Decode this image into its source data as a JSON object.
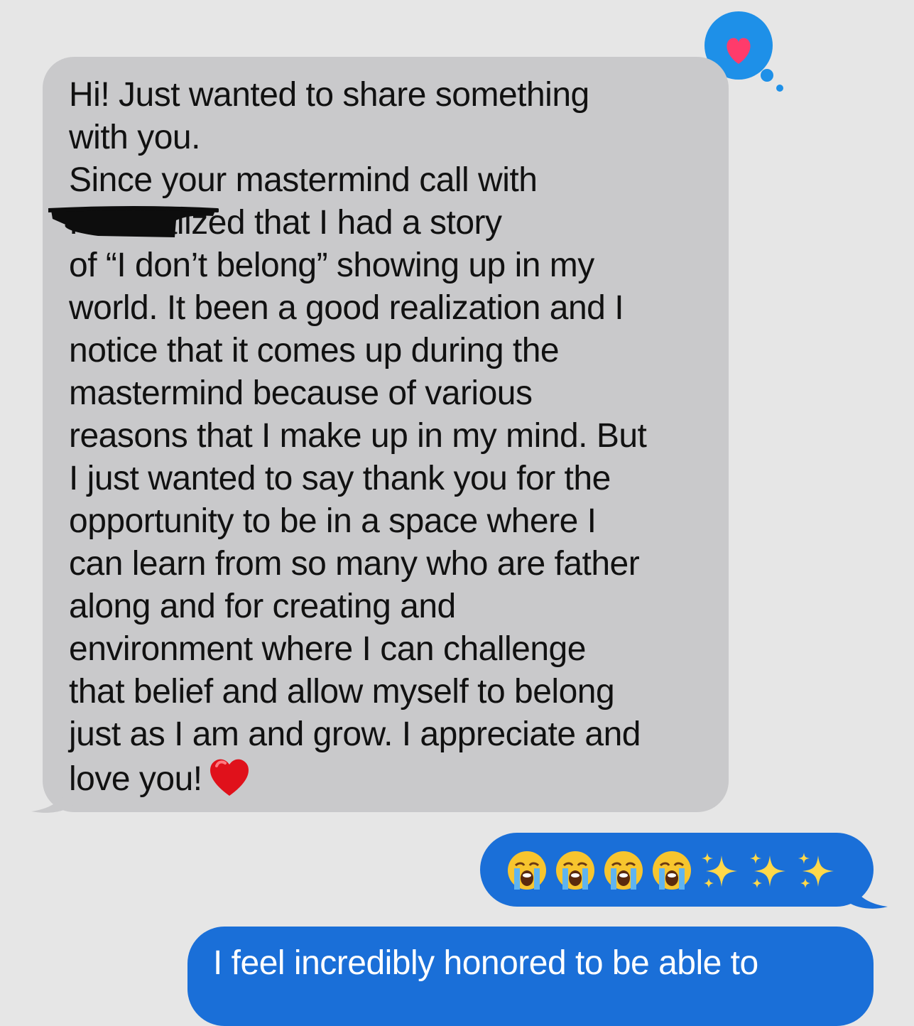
{
  "conversation": {
    "incoming_message": {
      "text": "Hi! Just wanted to share something\nwith you.\nSince your mastermind call with\n             I've realized that I had a story\nof “I don’t belong” showing up in my\nworld. It been a good realization and I\nnotice that it comes up during the\nmastermind because of various\nreasons that I make up in my mind. But\nI just wanted to say thank you for the\nopportunity to be in a space where I\ncan learn from so many who are father\nalong and for creating and\nenvironment where I can challenge\nthat belief and allow myself to belong\njust as I am and grow. I appreciate and\nlove you!",
      "trailing_emoji": "red-heart",
      "redacted": true,
      "tapback": "heart",
      "bubble_color": "#c9c9cb"
    },
    "outgoing_messages": [
      {
        "emojis": [
          "loudly-crying-face",
          "loudly-crying-face",
          "loudly-crying-face",
          "loudly-crying-face",
          "sparkles",
          "sparkles",
          "sparkles"
        ],
        "bubble_color": "#1a6fd8"
      },
      {
        "text": "I feel incredibly honored to be able to",
        "bubble_color": "#1a6fd8"
      }
    ]
  },
  "colors": {
    "background": "#e6e6e6",
    "incoming_bubble": "#c9c9cb",
    "outgoing_bubble": "#1a6fd8",
    "tapback_bubble": "#1e90e8",
    "tapback_heart": "#ff3b6b"
  }
}
